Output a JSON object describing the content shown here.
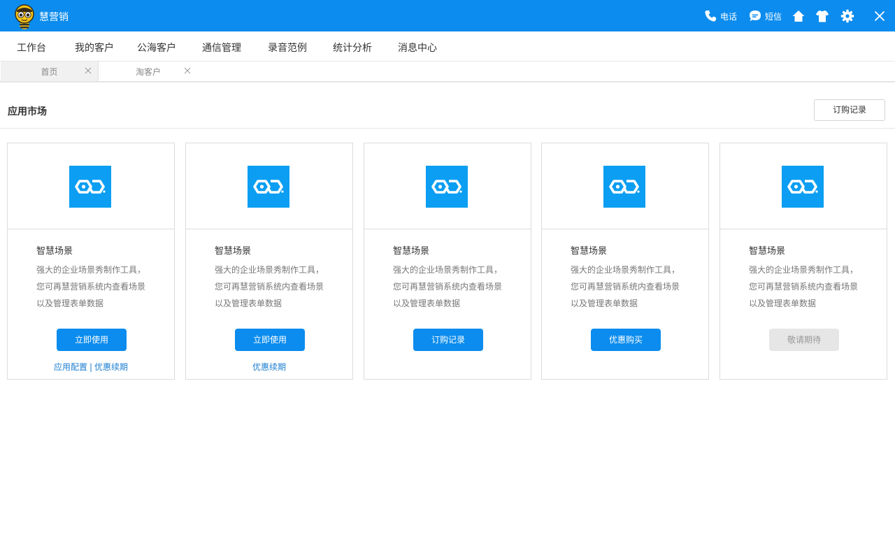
{
  "app": {
    "name": "慧营销"
  },
  "titlebar": {
    "phone_label": "电话",
    "sms_label": "短信"
  },
  "menu": {
    "items": [
      "工作台",
      "我的客户",
      "公海客户",
      "通信管理",
      "录音范例",
      "统计分析",
      "消息中心"
    ]
  },
  "tabs": [
    {
      "label": "首页"
    },
    {
      "label": "淘客户"
    }
  ],
  "section": {
    "title": "应用市场",
    "order_button": "订购记录"
  },
  "cards": [
    {
      "title": "智慧场景",
      "desc": [
        "强大的企业场景秀制作工具，",
        "您可再慧营销系统内查看场景",
        "以及管理表单数据"
      ],
      "button": "立即使用",
      "links": [
        "应用配置",
        "优惠续期"
      ]
    },
    {
      "title": "智慧场景",
      "desc": [
        "强大的企业场景秀制作工具，",
        "您可再慧营销系统内查看场景",
        "以及管理表单数据"
      ],
      "button": "立即使用",
      "links": [
        "优惠续期"
      ]
    },
    {
      "title": "智慧场景",
      "desc": [
        "强大的企业场景秀制作工具，",
        "您可再慧营销系统内查看场景",
        "以及管理表单数据"
      ],
      "button": "订购记录",
      "links": []
    },
    {
      "title": "智慧场景",
      "desc": [
        "强大的企业场景秀制作工具，",
        "您可再慧营销系统内查看场景",
        "以及管理表单数据"
      ],
      "button": "优惠购买",
      "links": []
    },
    {
      "title": "智慧场景",
      "desc": [
        "强大的企业场景秀制作工具，",
        "您可再慧营销系统内查看场景",
        "以及管理表单数据"
      ],
      "button": "敬请期待",
      "button_disabled": true,
      "links": []
    }
  ],
  "colors": {
    "brand": "#0b8cee",
    "app_icon": "#0b9ef2",
    "link": "#1d7fd0",
    "disabled_button": "#e6e6e6"
  },
  "icons": [
    "bee-logo-icon",
    "phone-icon",
    "sms-bubble-icon",
    "home-icon",
    "shirt-icon",
    "gear-icon",
    "close-icon",
    "tab-close-icon",
    "infinity-app-icon"
  ]
}
